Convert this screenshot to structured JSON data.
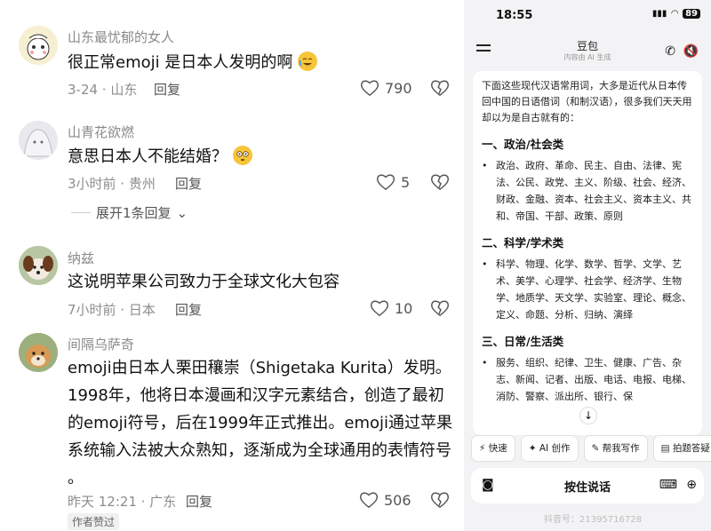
{
  "comments": [
    {
      "user": "山东最忧郁的女人",
      "text": "很正常emoji 是日本人发明的啊",
      "meta": "3-24 · 山东",
      "reply": "回复",
      "likes": "790"
    },
    {
      "user": "山青花欲燃",
      "text": "意思日本人不能结婚？",
      "meta": "3小时前 · 贵州",
      "reply": "回复",
      "likes": "5",
      "expand": "展开1条回复"
    },
    {
      "user": "纳兹",
      "text": "这说明苹果公司致力于全球文化大包容",
      "meta": "7小时前 · 日本",
      "reply": "回复",
      "likes": "10"
    },
    {
      "user": "间隔乌萨奇",
      "lines": [
        "emoji由日本人栗田穰崇（Shigetaka Kurita）发明。",
        "1998年，他将日本漫画和汉字元素结合，创造了最初",
        "的emoji符号，后在1999年正式推出。emoji通过苹果",
        "系统输入法被大众熟知，逐渐成为全球通用的表情符号",
        "。"
      ],
      "meta": "昨天 12:21 · 广东",
      "reply": "回复",
      "likes": "506",
      "badge": "作者赞过"
    }
  ],
  "phone": {
    "time": "18:55",
    "battery": "89",
    "title": "豆包",
    "subtitle": "内容由 AI 生成",
    "intro": "下面这些现代汉语常用词，大多是近代从日本传回中国的日语借词（和制汉语），很多我们天天用却以为是自古就有的：",
    "sections": [
      {
        "title": "一、政治/社会类",
        "body": "政治、政府、革命、民主、自由、法律、宪法、公民、政党、主义、阶级、社会、经济、财政、金融、资本、社会主义、资本主义、共和、帝国、干部、政策、原则"
      },
      {
        "title": "二、科学/学术类",
        "body": "科学、物理、化学、数学、哲学、文学、艺术、美学、心理学、社会学、经济学、生物学、地质学、天文学、实验室、理论、概念、定义、命题、分析、归纳、演绎"
      },
      {
        "title": "三、日常/生活类",
        "body": "服务、组织、纪律、卫生、健康、广告、杂志、新闻、记者、出版、电话、电报、电梯、消防、警察、派出所、银行、保"
      }
    ],
    "chips": [
      "快速",
      "AI 创作",
      "帮我写作",
      "拍题答疑"
    ],
    "input_label": "按住说话",
    "watermark": "抖音号：21395716728"
  }
}
